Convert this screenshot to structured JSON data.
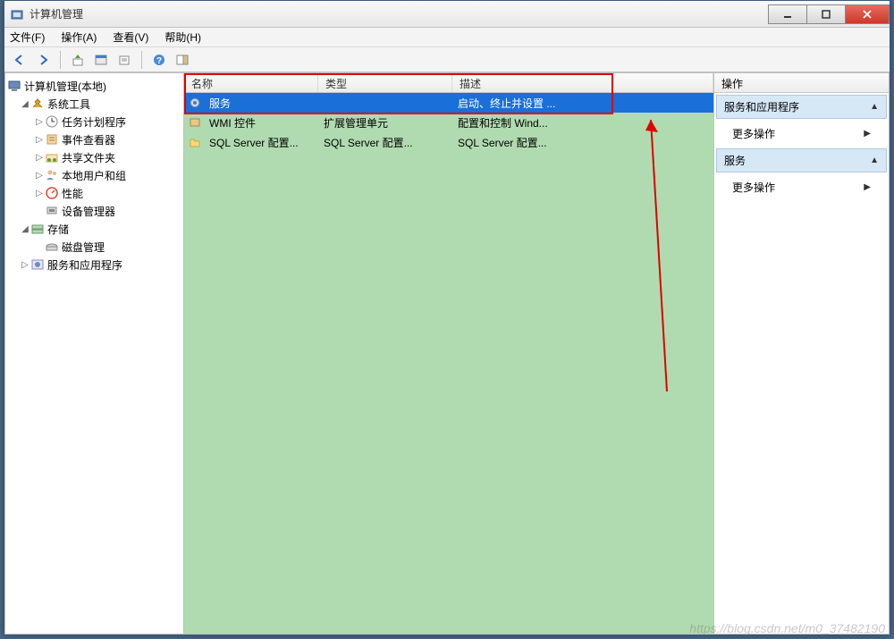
{
  "window": {
    "title": "计算机管理"
  },
  "menubar": {
    "file": "文件(F)",
    "action": "操作(A)",
    "view": "查看(V)",
    "help": "帮助(H)"
  },
  "tree": {
    "root": "计算机管理(本地)",
    "system_tools": "系统工具",
    "task_scheduler": "任务计划程序",
    "event_viewer": "事件查看器",
    "shared_folders": "共享文件夹",
    "local_users": "本地用户和组",
    "performance": "性能",
    "device_manager": "设备管理器",
    "storage": "存储",
    "disk_management": "磁盘管理",
    "services_apps": "服务和应用程序"
  },
  "list": {
    "headers": {
      "name": "名称",
      "type": "类型",
      "desc": "描述"
    },
    "rows": [
      {
        "name": "服务",
        "type": "",
        "desc": "启动、终止并设置 ...",
        "selected": true,
        "icon": "gear-icon"
      },
      {
        "name": "WMI 控件",
        "type": "扩展管理单元",
        "desc": "配置和控制 Wind...",
        "selected": false,
        "icon": "wmi-icon"
      },
      {
        "name": "SQL Server 配置...",
        "type": "SQL Server 配置...",
        "desc": "SQL Server 配置...",
        "selected": false,
        "icon": "folder-icon"
      }
    ]
  },
  "actions": {
    "title": "操作",
    "section1": "服务和应用程序",
    "more1": "更多操作",
    "section2": "服务",
    "more2": "更多操作"
  },
  "watermark": "https://blog.csdn.net/m0_37482190"
}
